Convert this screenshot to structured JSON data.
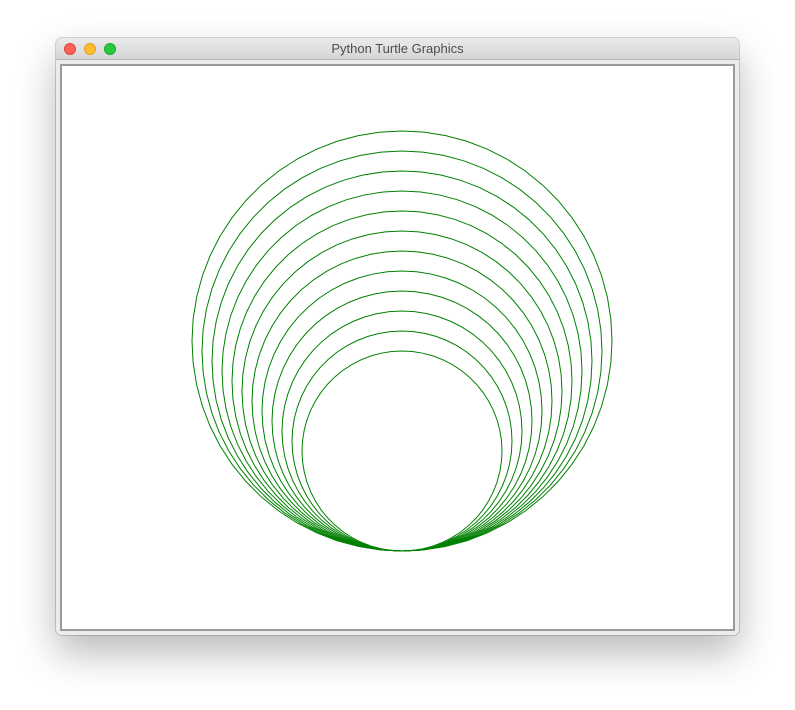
{
  "window": {
    "title": "Python Turtle Graphics"
  },
  "controls": {
    "close": "close-icon",
    "minimize": "minimize-icon",
    "zoom": "zoom-icon"
  },
  "drawing": {
    "pen_color": "#008000",
    "shape": "circle",
    "circle_count": 12,
    "radius_step": 10,
    "min_radius": 100
  }
}
